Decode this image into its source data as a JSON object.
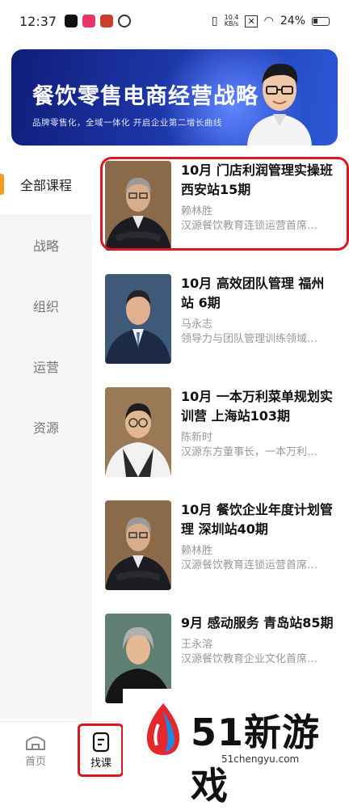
{
  "status_bar": {
    "time": "12:37",
    "net_speed_top": "10.4",
    "net_speed_bottom": "KB/s",
    "battery": "24%"
  },
  "banner": {
    "title": "餐饮零售电商经营战略",
    "subtitle": "品牌零售化，全域一体化   开启企业第二增长曲线"
  },
  "sidebar": {
    "items": [
      {
        "label": "全部课程",
        "active": true
      },
      {
        "label": "战略",
        "active": false
      },
      {
        "label": "组织",
        "active": false
      },
      {
        "label": "运营",
        "active": false
      },
      {
        "label": "资源",
        "active": false
      }
    ]
  },
  "courses": [
    {
      "title": "10月 门店利润管理实操班 西安站15期",
      "teacher": "赖林胜",
      "desc": "汉源餐饮教育连锁运营首席…"
    },
    {
      "title": "10月  高效团队管理 福州站 6期",
      "teacher": "马永志",
      "desc": "领导力与团队管理训练领域…"
    },
    {
      "title": "10月 一本万利菜单规划实训营 上海站103期",
      "teacher": "陈新时",
      "desc": "汉源东方董事长，一本万利…"
    },
    {
      "title": "10月 餐饮企业年度计划管理 深圳站40期",
      "teacher": "赖林胜",
      "desc": "汉源餐饮教育连锁运营首席…"
    },
    {
      "title": "9月 感动服务 青岛站85期",
      "teacher": "王永溶",
      "desc": "汉源餐饮教育企业文化首席…"
    }
  ],
  "tabbar": {
    "home_label": "首页",
    "courses_label": "找课"
  },
  "watermark": {
    "brand": "51新游戏",
    "url": "51chengyu.com"
  },
  "colors": {
    "accent": "#f59a23",
    "highlight": "#d9191f",
    "banner": "#1f3bb0"
  }
}
